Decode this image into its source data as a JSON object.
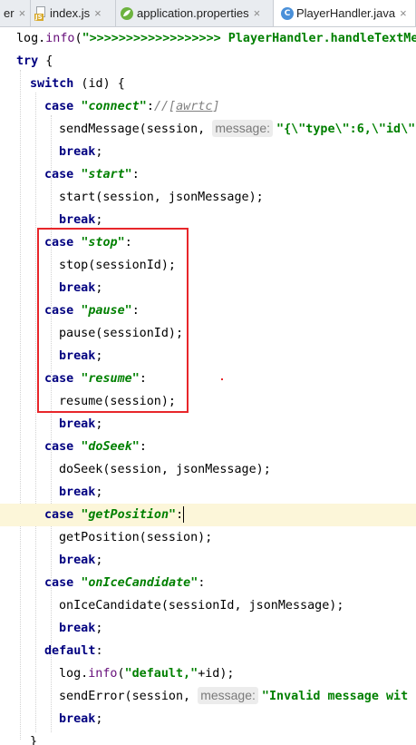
{
  "tabs": [
    {
      "label": "er",
      "close": "×",
      "icon": "none"
    },
    {
      "label": "index.js",
      "close": "×",
      "icon": "js-file-icon"
    },
    {
      "label": "application.properties",
      "close": "×",
      "icon": "properties-file-icon"
    },
    {
      "label": "PlayerHandler.java",
      "close": "×",
      "icon": "java-class-icon",
      "active": true
    }
  ],
  "code": {
    "l1": {
      "a": "log.",
      "b": "info",
      "c": "(",
      "d": "\">>>>>>>>>>>>>>>>>> PlayerHandler.handleTextMess"
    },
    "l2": {
      "a": "try",
      "b": " {"
    },
    "l3": {
      "a": "switch",
      "b": " (id) {"
    },
    "l4": {
      "a": "case",
      "b": " ",
      "c": "\"connect\"",
      "d": ":",
      "e": "//[",
      "f": "awrtc",
      "g": "]"
    },
    "l5": {
      "a": "sendMessage(session, ",
      "hint": "message:",
      "b": " ",
      "c": "\"{\\\"type\\\":6,\\\"id\\\""
    },
    "l6": {
      "a": "break",
      "b": ";"
    },
    "l7": {
      "a": "case",
      "b": " ",
      "c": "\"start\"",
      "d": ":"
    },
    "l8": {
      "a": "start(session, jsonMessage);"
    },
    "l9": {
      "a": "break",
      "b": ";"
    },
    "l10": {
      "a": "case",
      "b": " ",
      "c": "\"stop\"",
      "d": ":"
    },
    "l11": {
      "a": "stop(sessionId);"
    },
    "l12": {
      "a": "break",
      "b": ";"
    },
    "l13": {
      "a": "case",
      "b": " ",
      "c": "\"pause\"",
      "d": ":"
    },
    "l14": {
      "a": "pause(sessionId);"
    },
    "l15": {
      "a": "break",
      "b": ";"
    },
    "l16": {
      "a": "case",
      "b": " ",
      "c": "\"resume\"",
      "d": ":"
    },
    "l17": {
      "a": "resume(session);"
    },
    "l18": {
      "a": "break",
      "b": ";"
    },
    "l19": {
      "a": "case",
      "b": " ",
      "c": "\"doSeek\"",
      "d": ":"
    },
    "l20": {
      "a": "doSeek(session, jsonMessage);"
    },
    "l21": {
      "a": "break",
      "b": ";"
    },
    "l22": {
      "a": "case",
      "b": " ",
      "c": "\"getPosition\"",
      "d": ":"
    },
    "l23": {
      "a": "getPosition(session);"
    },
    "l24": {
      "a": "break",
      "b": ";"
    },
    "l25": {
      "a": "case",
      "b": " ",
      "c": "\"onIceCandidate\"",
      "d": ":"
    },
    "l26": {
      "a": "onIceCandidate(sessionId, jsonMessage);"
    },
    "l27": {
      "a": "break",
      "b": ";"
    },
    "l28": {
      "a": "default",
      "b": ":"
    },
    "l29": {
      "a": "log.",
      "b": "info",
      "c": "(",
      "d": "\"default,\"",
      "e": "+id);"
    },
    "l30": {
      "a": "sendError(session, ",
      "hint": "message:",
      "b": " ",
      "c": "\"Invalid message wit"
    },
    "l31": {
      "a": "break",
      "b": ";"
    },
    "l32": {
      "a": "}"
    }
  },
  "colors": {
    "keyword": "#000080",
    "string": "#008000",
    "comment": "#808080",
    "field": "#660e7a",
    "highlight_line": "#fcf6d9",
    "annotation_box": "#e8262a"
  }
}
